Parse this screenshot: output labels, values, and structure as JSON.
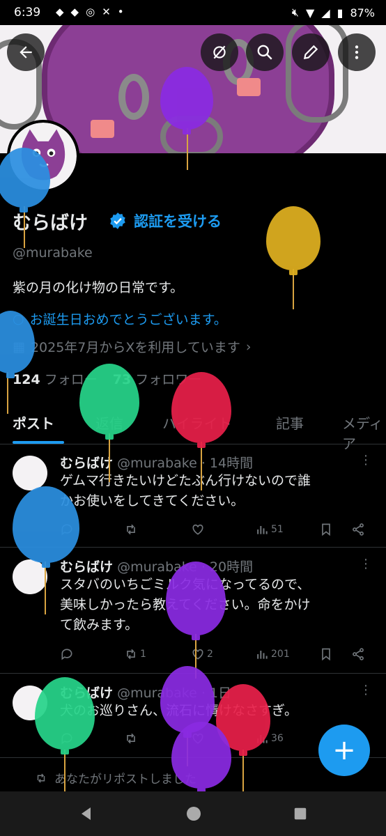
{
  "status_bar": {
    "time": "6:39",
    "battery": "87%"
  },
  "profile": {
    "name": "むらばけ",
    "get_verified": "認証を受ける",
    "handle": "@murabake",
    "bio": "紫の月の化け物の日常です。",
    "birthday": "お誕生日おめでとうございます。",
    "joined": "2025年7月からXを利用しています",
    "following_count": "124",
    "following_label": "フォロー",
    "followers_count": "73",
    "followers_label": "フォロワー"
  },
  "tabs": [
    "ポスト",
    "返信",
    "ハイライト",
    "記事",
    "メディア"
  ],
  "posts": [
    {
      "name": "むらばけ",
      "meta": "@murabake · 14時間",
      "text_lines": [
        "ゲムマ行きたいけどたぶん行けないので誰",
        "かお使いをしてきてください。"
      ],
      "reposts": "",
      "likes": "",
      "views": "51"
    },
    {
      "name": "むらばけ",
      "meta": "@murabake · 20時間",
      "text_lines": [
        "スタバのいちごミルク気になってるので、",
        "美味しかったら教えてください。命をかけ",
        "て飲みます。"
      ],
      "reposts": "1",
      "likes": "2",
      "views": "201"
    },
    {
      "name": "むらばけ",
      "meta": "@murabake · 1日",
      "text_lines": [
        "犬のお巡りさん、流石に情けなさすぎ。"
      ],
      "reposts": "",
      "likes": "",
      "views": "36"
    }
  ],
  "repost_note": "あなたがリポストしました",
  "colors": {
    "accent": "#1d9bf0",
    "background": "#000000",
    "muted": "#71767b"
  }
}
